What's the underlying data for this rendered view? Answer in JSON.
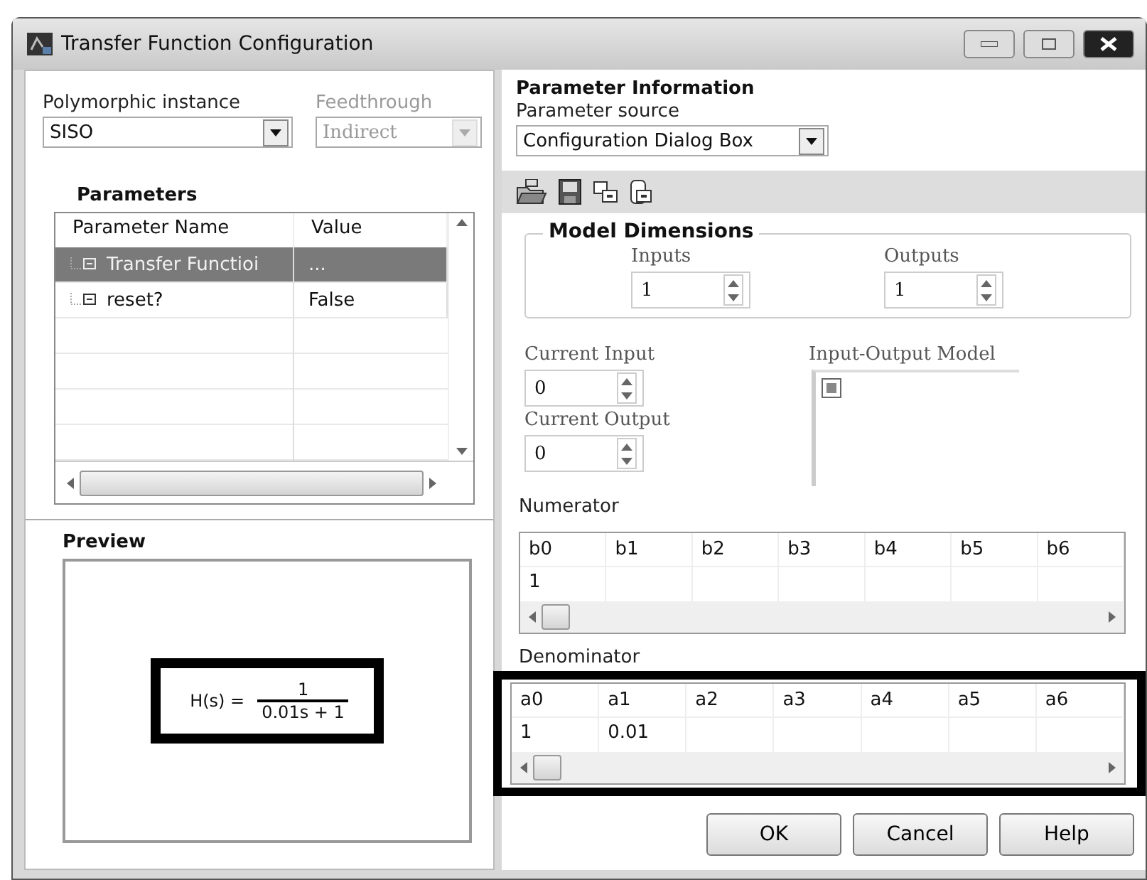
{
  "window": {
    "title": "Transfer Function Configuration"
  },
  "polymorphic": {
    "label": "Polymorphic instance",
    "value": "SISO",
    "disabled": false
  },
  "feedthrough": {
    "label": "Feedthrough",
    "value": "Indirect",
    "disabled": true
  },
  "parameters": {
    "title": "Parameters",
    "columns": [
      "Parameter Name",
      "Value"
    ],
    "rows": [
      {
        "name": "Transfer Functioi",
        "value": "...",
        "selected": true
      },
      {
        "name": "reset?",
        "value": "False",
        "selected": false
      }
    ]
  },
  "preview": {
    "title": "Preview",
    "lhs": "H(s) =",
    "numerator": "1",
    "denominator": "0.01s + 1"
  },
  "parameter_information": {
    "title": "Parameter Information",
    "source_label": "Parameter source",
    "source_value": "Configuration Dialog Box"
  },
  "model_dimensions": {
    "title": "Model Dimensions",
    "inputs": {
      "label": "Inputs",
      "value": "1"
    },
    "outputs": {
      "label": "Outputs",
      "value": "1"
    }
  },
  "current_input": {
    "label": "Current Input",
    "value": "0"
  },
  "current_output": {
    "label": "Current Output",
    "value": "0"
  },
  "io_model": {
    "label": "Input-Output Model"
  },
  "numerator": {
    "label": "Numerator",
    "columns": [
      "b0",
      "b1",
      "b2",
      "b3",
      "b4",
      "b5",
      "b6"
    ],
    "values": [
      "1"
    ],
    "highlighted": false
  },
  "denominator": {
    "label": "Denominator",
    "columns": [
      "a0",
      "a1",
      "a2",
      "a3",
      "a4",
      "a5",
      "a6"
    ],
    "values": [
      "1",
      "0.01"
    ],
    "highlighted": true
  },
  "buttons": [
    "OK",
    "Cancel",
    "Help"
  ]
}
